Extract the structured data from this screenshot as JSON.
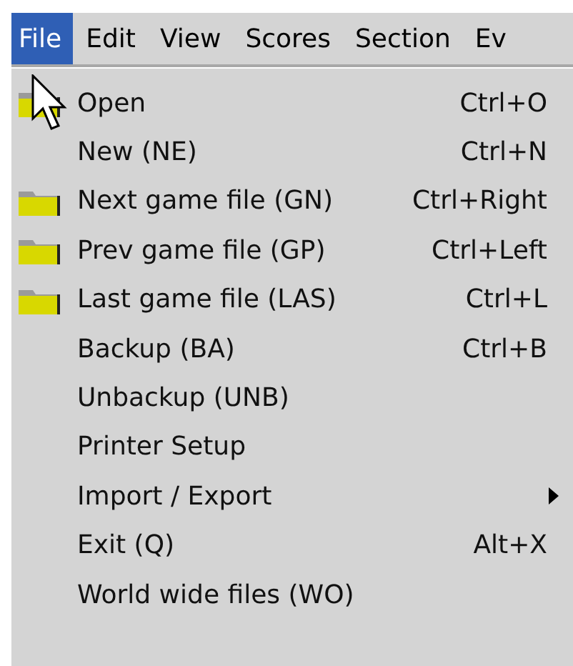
{
  "menu_bar": [
    {
      "label": "File",
      "selected": true
    },
    {
      "label": "Edit",
      "selected": false
    },
    {
      "label": "View",
      "selected": false
    },
    {
      "label": "Scores",
      "selected": false
    },
    {
      "label": "Section",
      "selected": false
    },
    {
      "label": "Ev",
      "selected": false
    }
  ],
  "file_menu": [
    {
      "label": "Open",
      "shortcut": "Ctrl+O",
      "kind": "folder"
    },
    {
      "label": "New (NE)",
      "shortcut": "Ctrl+N",
      "kind": "plain"
    },
    {
      "label": "Next game file (GN)",
      "shortcut": "Ctrl+Right",
      "kind": "folder"
    },
    {
      "label": "Prev game file (GP)",
      "shortcut": "Ctrl+Left",
      "kind": "folder"
    },
    {
      "label": "Last game file (LAS)",
      "shortcut": "Ctrl+L",
      "kind": "folder"
    },
    {
      "label": "Backup (BA)",
      "shortcut": "Ctrl+B",
      "kind": "plain"
    },
    {
      "label": "Unbackup (UNB)",
      "kind": "plain"
    },
    {
      "label": "Printer Setup",
      "kind": "plain"
    },
    {
      "label": "Import / Export",
      "kind": "submenu"
    },
    {
      "label": "Exit (Q)",
      "shortcut": "Alt+X",
      "kind": "plain"
    },
    {
      "label": "World wide files (WO)",
      "kind": "plain"
    }
  ]
}
